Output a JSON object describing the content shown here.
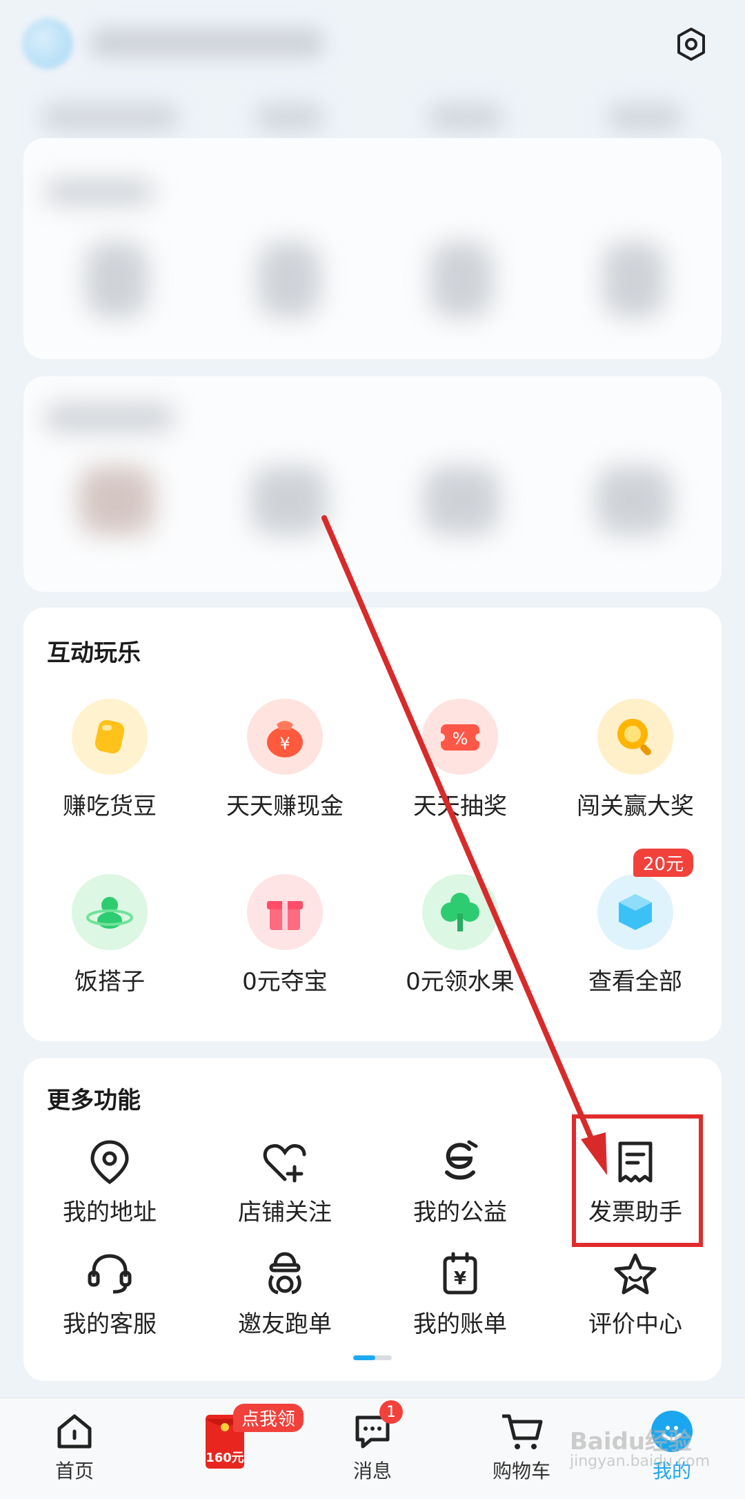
{
  "sections": {
    "interactive": {
      "title": "互动玩乐",
      "items": [
        {
          "label": "赚吃货豆",
          "icon": "bean-icon"
        },
        {
          "label": "天天赚现金",
          "icon": "money-bag-icon"
        },
        {
          "label": "天天抽奖",
          "icon": "coupon-icon"
        },
        {
          "label": "闯关赢大奖",
          "icon": "magnifier-icon"
        },
        {
          "label": "饭搭子",
          "icon": "planet-person-icon"
        },
        {
          "label": "0元夺宝",
          "icon": "gift-box-icon"
        },
        {
          "label": "0元领水果",
          "icon": "tree-icon"
        },
        {
          "label": "查看全部",
          "icon": "cube-icon"
        }
      ],
      "badge": "20元"
    },
    "more": {
      "title": "更多功能",
      "items": [
        {
          "label": "我的地址",
          "icon": "location-pin-icon"
        },
        {
          "label": "店铺关注",
          "icon": "heart-plus-icon"
        },
        {
          "label": "我的公益",
          "icon": "charity-icon"
        },
        {
          "label": "发票助手",
          "icon": "invoice-icon"
        },
        {
          "label": "我的客服",
          "icon": "headset-icon"
        },
        {
          "label": "邀友跑单",
          "icon": "rider-icon"
        },
        {
          "label": "我的账单",
          "icon": "bill-icon"
        },
        {
          "label": "评价中心",
          "icon": "star-icon"
        }
      ]
    }
  },
  "bottom_nav": {
    "items": [
      {
        "label": "首页",
        "icon": "home-icon"
      },
      {
        "label": "",
        "icon": "red-envelope-icon"
      },
      {
        "label": "消息",
        "icon": "chat-icon"
      },
      {
        "label": "购物车",
        "icon": "cart-icon"
      },
      {
        "label": "我的",
        "icon": "profile-icon"
      }
    ],
    "promo_badge": "点我领",
    "envelope_text": "160元",
    "message_count": "1"
  },
  "watermark": {
    "text": "Baidu经验",
    "sub": "jingyan.baidu.com"
  },
  "colors": {
    "accent": "#1ba7ef",
    "badge": "#f2413b",
    "highlight": "#e02c2c",
    "arrow": "#d92a2a"
  }
}
